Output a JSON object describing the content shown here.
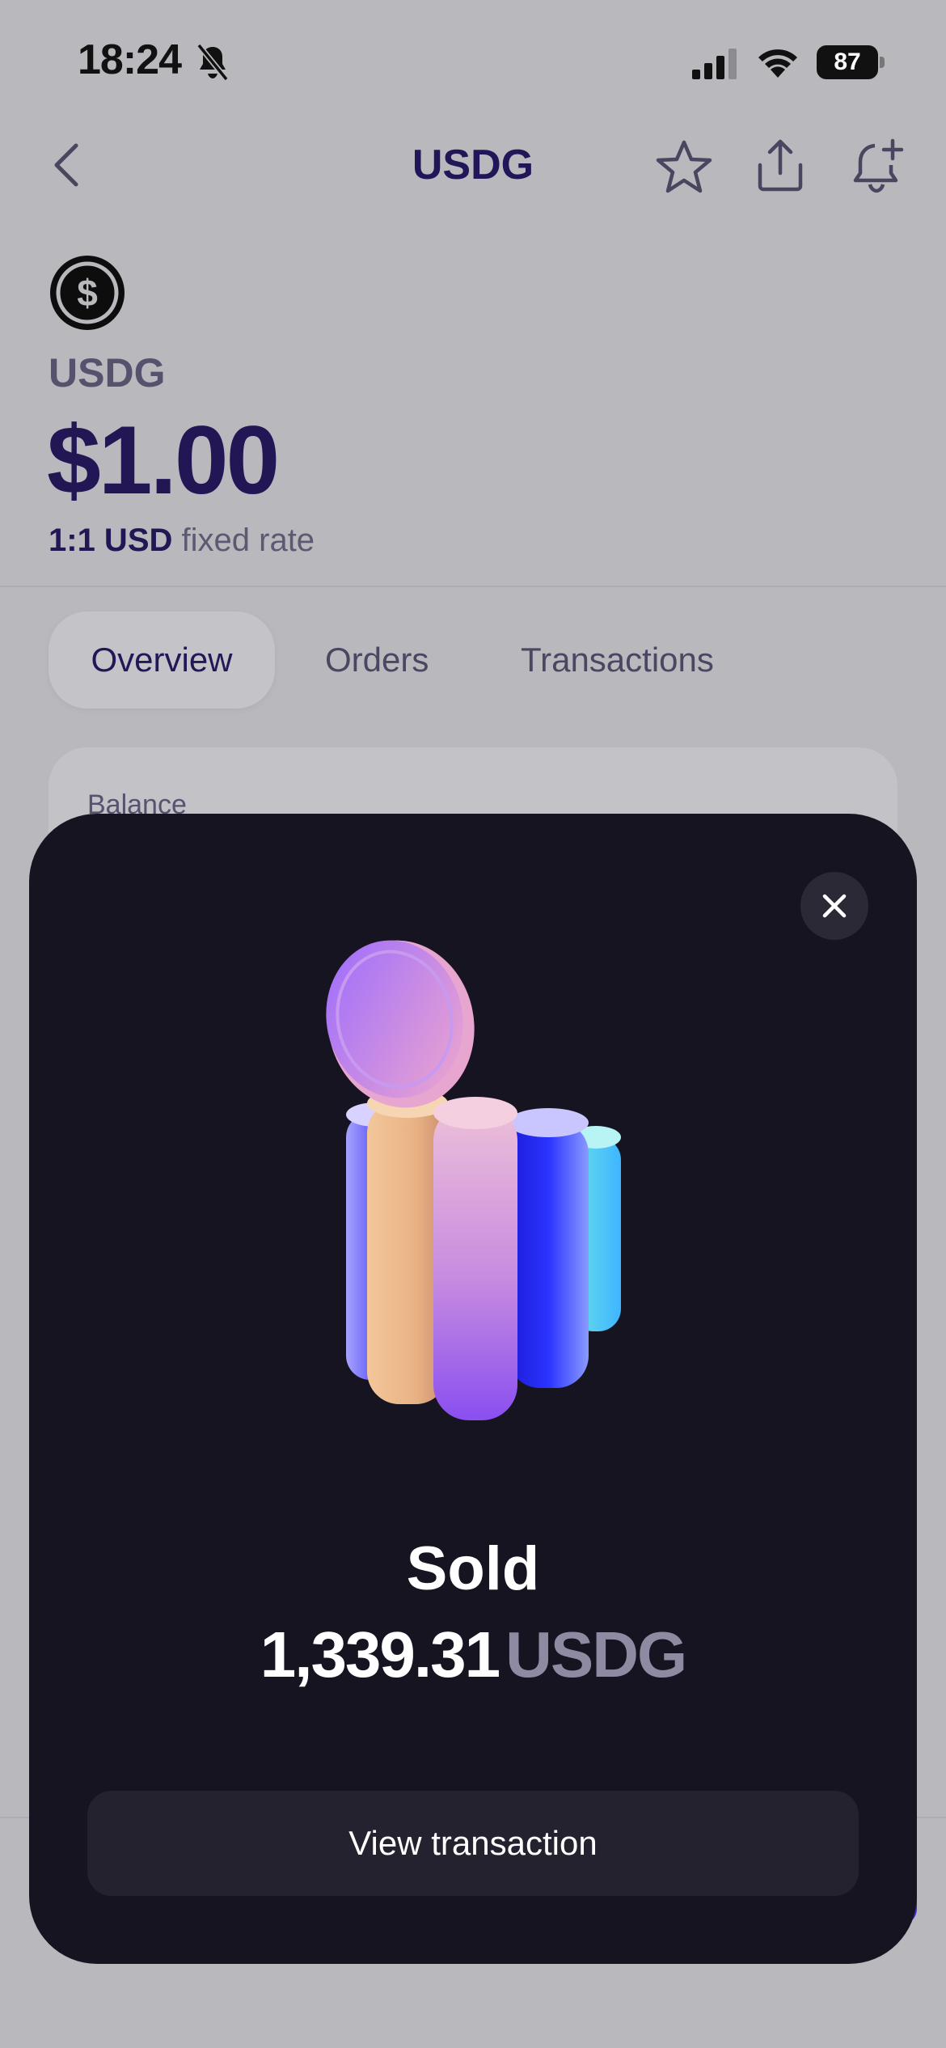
{
  "status_bar": {
    "time": "18:24",
    "battery": "87",
    "icons": [
      "bell-slash-icon",
      "signal-icon",
      "wifi-icon",
      "battery-icon"
    ]
  },
  "header": {
    "title": "USDG",
    "icons": [
      "chevron-left-icon",
      "star-icon",
      "share-icon",
      "bell-plus-icon"
    ]
  },
  "token": {
    "name": "USDG",
    "price": "$1.00",
    "rate_strong": "1:1 USD",
    "rate_rest": "fixed rate"
  },
  "tabs": [
    {
      "label": "Overview",
      "active": true
    },
    {
      "label": "Orders",
      "active": false
    },
    {
      "label": "Transactions",
      "active": false
    }
  ],
  "balance_card": {
    "label": "Balance"
  },
  "modal": {
    "title": "Sold",
    "amount": "1,339.31",
    "unit": "USDG",
    "button": "View transaction",
    "close_icon": "close-icon"
  },
  "colors": {
    "background_dim": "#b9b8bd",
    "modal_bg": "#171421",
    "accent_text": "#221655",
    "button_bg": "#25222f"
  }
}
